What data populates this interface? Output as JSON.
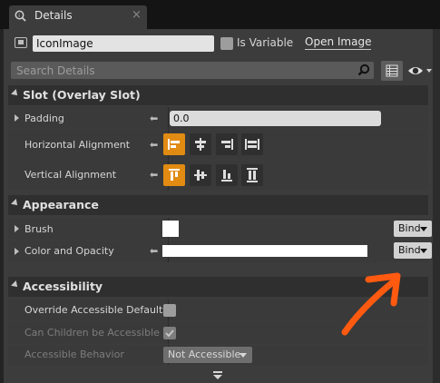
{
  "tab": {
    "title": "Details",
    "close": "×"
  },
  "header": {
    "widget_name": "IconImage",
    "is_variable_label": "Is Variable",
    "open_image_label": "Open Image"
  },
  "search": {
    "placeholder": "Search Details"
  },
  "sections": {
    "slot": {
      "title": "Slot (Overlay Slot)",
      "padding_label": "Padding",
      "padding_value": "0.0",
      "halign_label": "Horizontal Alignment",
      "valign_label": "Vertical Alignment"
    },
    "appearance": {
      "title": "Appearance",
      "brush_label": "Brush",
      "brush_bind": "Bind",
      "color_label": "Color and Opacity",
      "color_bind": "Bind"
    },
    "accessibility": {
      "title": "Accessibility",
      "override_label": "Override Accessible Defaults",
      "children_label": "Can Children be Accessible",
      "behavior_label": "Accessible Behavior",
      "behavior_value": "Not Accessible"
    }
  },
  "colors": {
    "accent": "#e28b12",
    "annotation_arrow": "#ff5a10",
    "panel": "#3c3c3c"
  }
}
